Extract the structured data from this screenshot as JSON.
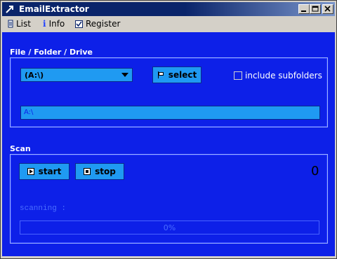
{
  "window": {
    "title": "EmailExtractor"
  },
  "menu": {
    "list": "List",
    "info": "Info",
    "register": "Register"
  },
  "file_section": {
    "label": "File / Folder / Drive",
    "drive_selected": "(A:\\)",
    "select_button": "select",
    "include_subfolders": "include subfolders",
    "path_value": "A:\\"
  },
  "scan_section": {
    "label": "Scan",
    "start_button": "start",
    "stop_button": "stop",
    "count": "0",
    "status": "scanning :",
    "progress_percent": 0,
    "progress_text": "0%"
  },
  "colors": {
    "background": "#0d20e8",
    "control": "#1f9af2",
    "titlebar": "#0a246a"
  }
}
